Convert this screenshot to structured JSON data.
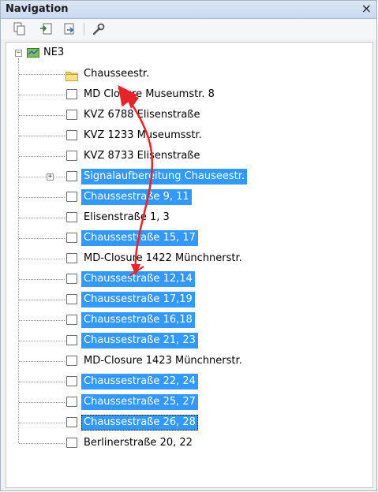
{
  "panel": {
    "title": "Navigation",
    "close_glyph": "×"
  },
  "toolbar": {
    "buttons": [
      {
        "name": "copy-icon"
      },
      {
        "name": "import-icon"
      },
      {
        "name": "export-icon"
      },
      {
        "name": "wrench-icon"
      }
    ]
  },
  "tree": {
    "root": {
      "label": "NE3",
      "icon": "network-map-icon",
      "expander": "−"
    },
    "items": [
      {
        "label": "Chausseestr.",
        "icon": "folder-icon",
        "selected": false
      },
      {
        "label": "MD Closure Museumstr. 8",
        "icon": "node-icon",
        "selected": false
      },
      {
        "label": "KVZ 6788 Elisenstraße",
        "icon": "node-icon",
        "selected": false
      },
      {
        "label": "KVZ 1233 Museumsstr.",
        "icon": "node-icon",
        "selected": false
      },
      {
        "label": "KVZ 8733 Elisenstraße",
        "icon": "node-icon",
        "selected": false
      },
      {
        "label": "Signalaufbereitung Chauseestr.",
        "icon": "node-icon",
        "selected": true,
        "expander": "+"
      },
      {
        "label": "Chaussestraße  9, 11",
        "icon": "node-icon",
        "selected": true
      },
      {
        "label": "Elisenstraße 1, 3",
        "icon": "node-icon",
        "selected": false
      },
      {
        "label": "Chaussestraße  15, 17",
        "icon": "node-icon",
        "selected": true
      },
      {
        "label": "MD-Closure 1422 Münchnerstr.",
        "icon": "node-icon",
        "selected": false
      },
      {
        "label": "Chaussestraße 12,14",
        "icon": "node-icon",
        "selected": true
      },
      {
        "label": "Chaussestraße  17,19",
        "icon": "node-icon",
        "selected": true
      },
      {
        "label": "Chaussestraße  16,18",
        "icon": "node-icon",
        "selected": true
      },
      {
        "label": "Chaussestraße  21, 23",
        "icon": "node-icon",
        "selected": true
      },
      {
        "label": "MD-Closure 1423 Münchnerstr.",
        "icon": "node-icon",
        "selected": false
      },
      {
        "label": "Chaussestraße  22, 24",
        "icon": "node-icon",
        "selected": true
      },
      {
        "label": "Chaussestraße  25, 27",
        "icon": "node-icon",
        "selected": true
      },
      {
        "label": "Chaussestraße  26, 28",
        "icon": "node-icon",
        "selected": true,
        "focused": true
      },
      {
        "label": "Berlinerstraße 20, 22",
        "icon": "node-icon",
        "selected": false
      }
    ]
  },
  "annotation": {
    "name": "drag-arrow",
    "color": "#e8232a"
  },
  "colors": {
    "selection": "#3399ff",
    "arrow": "#e8232a"
  }
}
